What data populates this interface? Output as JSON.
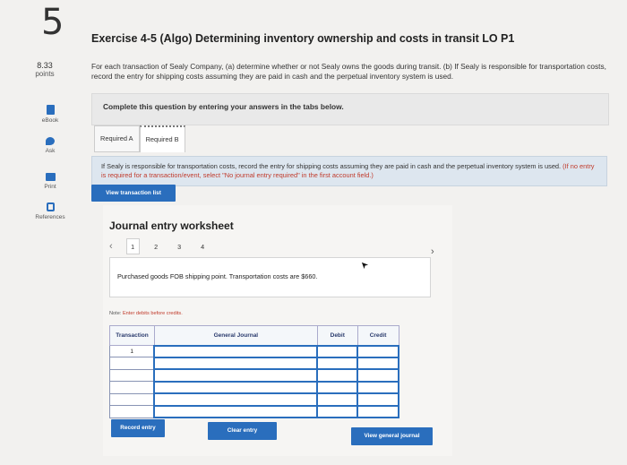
{
  "question": {
    "number": "5",
    "title": "Exercise 4-5 (Algo) Determining inventory ownership and costs in transit LO P1",
    "points_value": "8.33",
    "points_label": "points",
    "instructions": "For each transaction of Sealy Company, (a) determine whether or not Sealy owns the goods during transit. (b) If Sealy is responsible for transportation costs, record the entry for shipping costs assuming they are paid in cash and the perpetual inventory system is used."
  },
  "sidebar": {
    "items": [
      {
        "label": "eBook",
        "icon": "book-icon"
      },
      {
        "label": "Ask",
        "icon": "chat-icon"
      },
      {
        "label": "Print",
        "icon": "print-icon"
      },
      {
        "label": "References",
        "icon": "references-icon"
      }
    ]
  },
  "banner": {
    "text": "Complete this question by entering your answers in the tabs below."
  },
  "tabs": [
    {
      "label": "Required A",
      "active": false
    },
    {
      "label": "Required B",
      "active": true
    }
  ],
  "info": {
    "main": "If Sealy is responsible for transportation costs, record the entry for shipping costs assuming they are paid in cash and the perpetual inventory system is used.",
    "note": "(If no entry is required for a transaction/event, select \"No journal entry required\" in the first account field.)"
  },
  "buttons": {
    "view_transaction_list": "View transaction list",
    "record_entry": "Record entry",
    "clear_entry": "Clear entry",
    "view_general_journal": "View general journal"
  },
  "worksheet": {
    "title": "Journal entry worksheet",
    "pages": [
      "1",
      "2",
      "3",
      "4"
    ],
    "current_page": "1",
    "transaction_text": "Purchased goods FOB shipping point. Transportation costs are $660.",
    "note_prefix": "Note:",
    "note_text": "Enter debits before credits.",
    "table": {
      "headers": [
        "Transaction",
        "General Journal",
        "Debit",
        "Credit"
      ],
      "rows": [
        [
          "1",
          "",
          "",
          ""
        ],
        [
          "",
          "",
          "",
          ""
        ],
        [
          "",
          "",
          "",
          ""
        ],
        [
          "",
          "",
          "",
          ""
        ],
        [
          "",
          "",
          "",
          ""
        ],
        [
          "",
          "",
          "",
          ""
        ]
      ]
    }
  }
}
